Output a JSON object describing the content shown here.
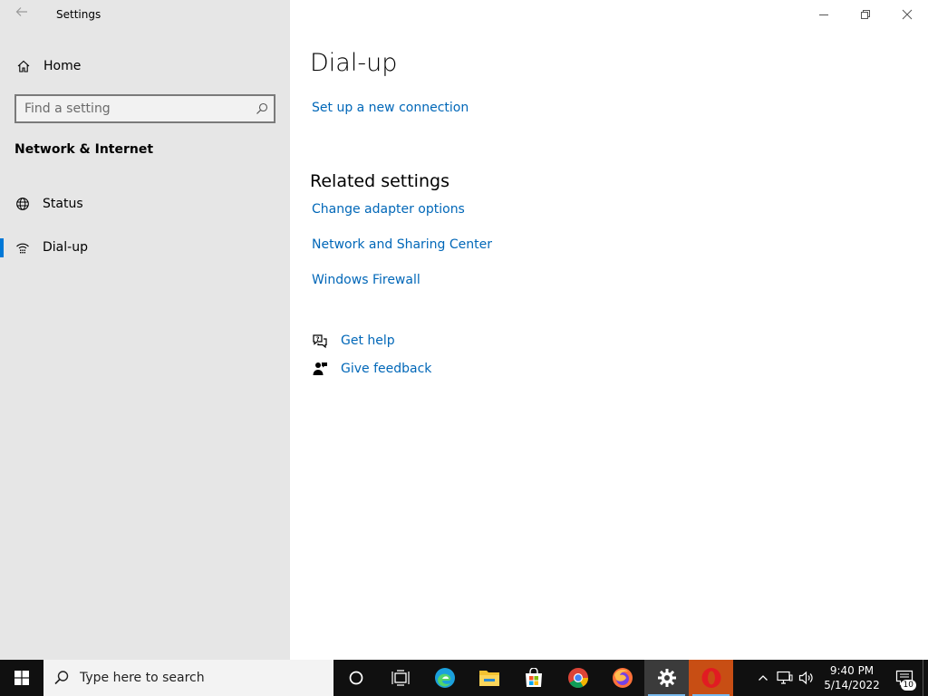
{
  "window": {
    "title": "Settings"
  },
  "sidebar": {
    "home_label": "Home",
    "search_placeholder": "Find a setting",
    "section_title": "Network & Internet",
    "items": [
      {
        "label": "Status",
        "icon": "globe-icon",
        "active": false
      },
      {
        "label": "Dial-up",
        "icon": "dialup-icon",
        "active": true
      }
    ]
  },
  "main": {
    "title": "Dial-up",
    "setup_link": "Set up a new connection",
    "related_heading": "Related settings",
    "related_links": [
      "Change adapter options",
      "Network and Sharing Center",
      "Windows Firewall"
    ],
    "help": {
      "get_help": "Get help",
      "give_feedback": "Give feedback"
    }
  },
  "taskbar": {
    "search_placeholder": "Type here to search",
    "apps": [
      "cortana-icon",
      "task-view-icon",
      "edge-icon",
      "file-explorer-icon",
      "store-icon",
      "chrome-icon",
      "firefox-icon",
      "settings-icon",
      "opera-icon"
    ],
    "clock": {
      "time": "9:40 PM",
      "date": "5/14/2022"
    },
    "notification_count": "10"
  },
  "colors": {
    "accent": "#0078d7",
    "link": "#0067b8",
    "sidebar_bg": "#e6e6e6",
    "taskbar_bg": "#101010"
  }
}
